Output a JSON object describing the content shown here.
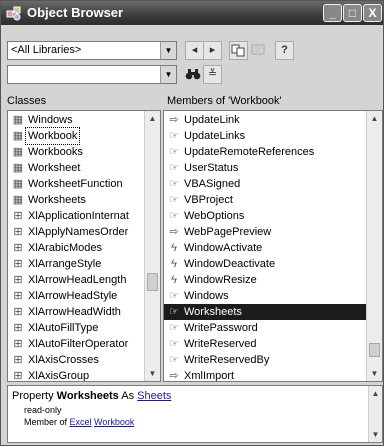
{
  "window": {
    "title": "Object Browser",
    "buttons": {
      "minimize": "_",
      "maximize": "□",
      "close": "X"
    }
  },
  "toolbar": {
    "library_combo": "<All Libraries>",
    "search_combo": "",
    "back_icon": "◂",
    "forward_icon": "▸",
    "help_icon": "?",
    "binoculars_icon": "🔍",
    "collapse_icon": "≚"
  },
  "classes": {
    "header": "Classes",
    "items": [
      {
        "label": "Windows",
        "icon": "class-icon"
      },
      {
        "label": "Workbook",
        "icon": "class-icon",
        "focused": true
      },
      {
        "label": "Workbooks",
        "icon": "class-icon"
      },
      {
        "label": "Worksheet",
        "icon": "class-icon"
      },
      {
        "label": "WorksheetFunction",
        "icon": "class-icon"
      },
      {
        "label": "Worksheets",
        "icon": "class-icon"
      },
      {
        "label": "XlApplicationInternat",
        "icon": "enum-icon"
      },
      {
        "label": "XlApplyNamesOrder",
        "icon": "enum-icon"
      },
      {
        "label": "XlArabicModes",
        "icon": "enum-icon"
      },
      {
        "label": "XlArrangeStyle",
        "icon": "enum-icon"
      },
      {
        "label": "XlArrowHeadLength",
        "icon": "enum-icon"
      },
      {
        "label": "XlArrowHeadStyle",
        "icon": "enum-icon"
      },
      {
        "label": "XlArrowHeadWidth",
        "icon": "enum-icon"
      },
      {
        "label": "XlAutoFillType",
        "icon": "enum-icon"
      },
      {
        "label": "XlAutoFilterOperator",
        "icon": "enum-icon"
      },
      {
        "label": "XlAxisCrosses",
        "icon": "enum-icon"
      },
      {
        "label": "XlAxisGroup",
        "icon": "enum-icon"
      }
    ]
  },
  "members": {
    "header": "Members of 'Workbook'",
    "items": [
      {
        "label": "UpdateLink",
        "icon": "method-icon"
      },
      {
        "label": "UpdateLinks",
        "icon": "property-icon"
      },
      {
        "label": "UpdateRemoteReferences",
        "icon": "property-icon"
      },
      {
        "label": "UserStatus",
        "icon": "property-icon"
      },
      {
        "label": "VBASigned",
        "icon": "property-icon"
      },
      {
        "label": "VBProject",
        "icon": "property-icon"
      },
      {
        "label": "WebOptions",
        "icon": "property-icon"
      },
      {
        "label": "WebPagePreview",
        "icon": "method-icon"
      },
      {
        "label": "WindowActivate",
        "icon": "event-icon"
      },
      {
        "label": "WindowDeactivate",
        "icon": "event-icon"
      },
      {
        "label": "WindowResize",
        "icon": "event-icon"
      },
      {
        "label": "Windows",
        "icon": "property-icon"
      },
      {
        "label": "Worksheets",
        "icon": "property-icon",
        "selected": true
      },
      {
        "label": "WritePassword",
        "icon": "property-icon"
      },
      {
        "label": "WriteReserved",
        "icon": "property-icon"
      },
      {
        "label": "WriteReservedBy",
        "icon": "property-icon"
      },
      {
        "label": "XmlImport",
        "icon": "method-icon"
      }
    ]
  },
  "details": {
    "prefix": "Property ",
    "member": "Worksheets",
    "as_text": " As ",
    "type_link": "Sheets",
    "line2": "read-only",
    "member_of_prefix": "Member of ",
    "library_link": "Excel",
    "class_link": "Workbook"
  },
  "colors": {
    "titlebar": "#3c3c3c",
    "selection": "#1c1c1c",
    "link": "#1a1aa0"
  }
}
